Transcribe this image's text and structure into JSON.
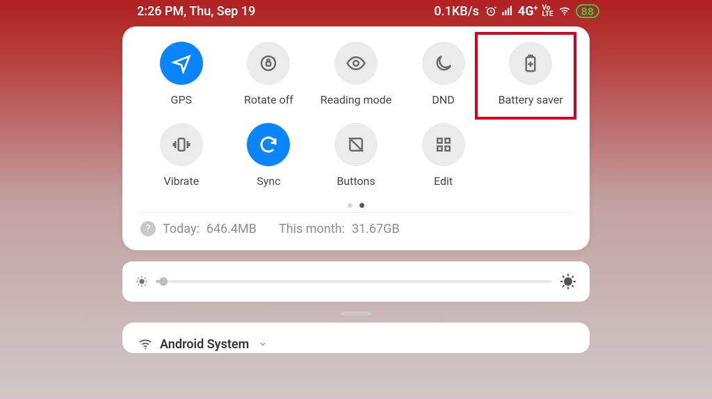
{
  "status_bar": {
    "time_date": "2:26 PM, Thu, Sep 19",
    "net_speed": "0.1KB/s",
    "network_label": "4G",
    "volte_label": "VoLTE",
    "battery_percent": "88"
  },
  "quick_settings": {
    "toggles": [
      {
        "id": "gps",
        "label": "GPS",
        "icon": "navigation-icon",
        "active": true
      },
      {
        "id": "rotate-off",
        "label": "Rotate off",
        "icon": "rotate-lock-icon",
        "active": false
      },
      {
        "id": "reading-mode",
        "label": "Reading mode",
        "icon": "eye-icon",
        "active": false
      },
      {
        "id": "dnd",
        "label": "DND",
        "icon": "moon-icon",
        "active": false
      },
      {
        "id": "battery-saver",
        "label": "Battery saver",
        "icon": "battery-plus-icon",
        "active": false
      },
      {
        "id": "vibrate",
        "label": "Vibrate",
        "icon": "vibrate-icon",
        "active": false
      },
      {
        "id": "sync",
        "label": "Sync",
        "icon": "sync-icon",
        "active": true
      },
      {
        "id": "buttons",
        "label": "Buttons",
        "icon": "buttons-icon",
        "active": false
      },
      {
        "id": "edit",
        "label": "Edit",
        "icon": "grid-icon",
        "active": false
      }
    ],
    "highlight_index": 4,
    "page_count": 2,
    "active_page": 1,
    "data_usage": {
      "today_label": "Today:",
      "today_value": "646.4MB",
      "month_label": "This month:",
      "month_value": "31.67GB"
    }
  },
  "brightness": {
    "percent": 2
  },
  "notification": {
    "app_name": "Android System",
    "icon": "wifi-icon"
  },
  "colors": {
    "accent": "#0a84ff",
    "highlight_border": "#d00022",
    "battery_green": "#2ecc40"
  }
}
